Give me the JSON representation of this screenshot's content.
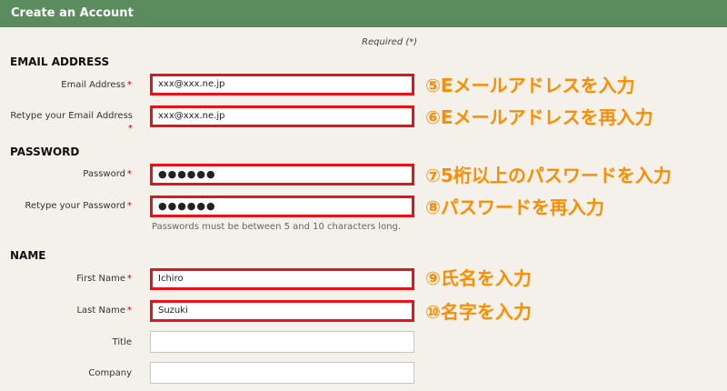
{
  "header": {
    "title": "Create an Account"
  },
  "required_note": "Required (*)",
  "required_mark": "*",
  "sections": {
    "email": "EMAIL ADDRESS",
    "password": "PASSWORD",
    "name": "NAME"
  },
  "fields": {
    "email": {
      "label": "Email Address",
      "value": "xxx@xxx.ne.jp"
    },
    "retype_email": {
      "label": "Retype your Email Address",
      "value": "xxx@xxx.ne.jp"
    },
    "password": {
      "label": "Password",
      "value": "●●●●●●"
    },
    "retype_password": {
      "label": "Retype your Password",
      "value": "●●●●●●"
    },
    "first_name": {
      "label": "First Name",
      "value": "Ichiro"
    },
    "last_name": {
      "label": "Last Name",
      "value": "Suzuki"
    },
    "title": {
      "label": "Title",
      "value": ""
    },
    "company": {
      "label": "Company",
      "value": ""
    }
  },
  "password_hint": "Passwords must be between 5 and 10 characters long.",
  "annotations": {
    "email": "⑤Eメールアドレスを入力",
    "retype_email": "⑥Eメールアドレスを再入力",
    "password": "⑦5桁以上のパスワードを入力",
    "retype_password": "⑧パスワードを再入力",
    "first_name": "⑨氏名を入力",
    "last_name": "⑩名字を入力"
  },
  "colors": {
    "header_bg": "#5b8c5e",
    "highlight_border": "#e8121b",
    "annotation_text": "#ff8c00",
    "required_star": "#cc0000"
  }
}
